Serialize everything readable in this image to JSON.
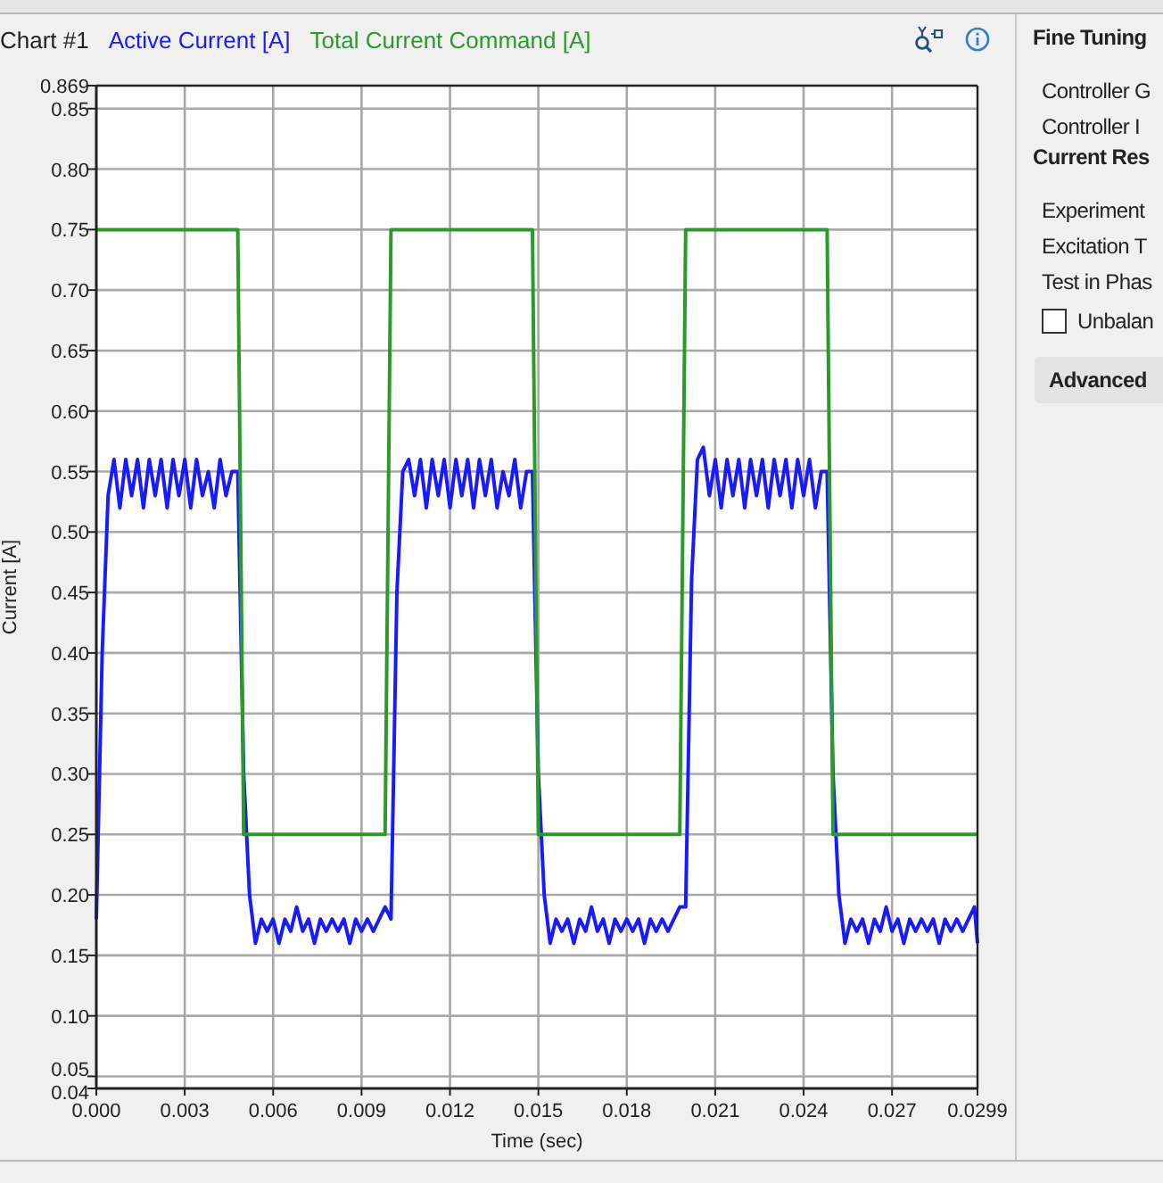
{
  "chart_panel": {
    "title": "Chart #1",
    "chart_data": {
      "type": "line",
      "grid": true,
      "xlabel": "Time (sec)",
      "ylabel": "Current [A]",
      "xlim": [
        0,
        0.0299
      ],
      "ylim": [
        0.04,
        0.869
      ],
      "xticks": [
        {
          "value": 0,
          "label": "0.000"
        },
        {
          "value": 0.003,
          "label": "0.003"
        },
        {
          "value": 0.006,
          "label": "0.006"
        },
        {
          "value": 0.009,
          "label": "0.009"
        },
        {
          "value": 0.012,
          "label": "0.012"
        },
        {
          "value": 0.015,
          "label": "0.015"
        },
        {
          "value": 0.018,
          "label": "0.018"
        },
        {
          "value": 0.021,
          "label": "0.021"
        },
        {
          "value": 0.024,
          "label": "0.024"
        },
        {
          "value": 0.027,
          "label": "0.027"
        },
        {
          "value": 0.0299,
          "label": "0.0299"
        }
      ],
      "yticks": [
        {
          "value": 0.04,
          "label": "0.04"
        },
        {
          "value": 0.05,
          "label": "0.05"
        },
        {
          "value": 0.1,
          "label": "0.10"
        },
        {
          "value": 0.15,
          "label": "0.15"
        },
        {
          "value": 0.2,
          "label": "0.20"
        },
        {
          "value": 0.25,
          "label": "0.25"
        },
        {
          "value": 0.3,
          "label": "0.30"
        },
        {
          "value": 0.35,
          "label": "0.35"
        },
        {
          "value": 0.4,
          "label": "0.40"
        },
        {
          "value": 0.45,
          "label": "0.45"
        },
        {
          "value": 0.5,
          "label": "0.50"
        },
        {
          "value": 0.55,
          "label": "0.55"
        },
        {
          "value": 0.6,
          "label": "0.60"
        },
        {
          "value": 0.65,
          "label": "0.65"
        },
        {
          "value": 0.7,
          "label": "0.70"
        },
        {
          "value": 0.75,
          "label": "0.75"
        },
        {
          "value": 0.8,
          "label": "0.80"
        },
        {
          "value": 0.85,
          "label": "0.85"
        },
        {
          "value": 0.869,
          "label": "0.869"
        }
      ],
      "x": [
        0,
        0.0002,
        0.0004,
        0.0006,
        0.0008,
        0.001,
        0.0012,
        0.0014,
        0.0016,
        0.0018,
        0.002,
        0.0022,
        0.0024,
        0.0026,
        0.0028,
        0.003,
        0.0032,
        0.0034,
        0.0036,
        0.0038,
        0.004,
        0.0042,
        0.0044,
        0.0046,
        0.0048,
        0.005,
        0.0052,
        0.0054,
        0.0056,
        0.0058,
        0.006,
        0.0062,
        0.0064,
        0.0066,
        0.0068,
        0.007,
        0.0072,
        0.0074,
        0.0076,
        0.0078,
        0.008,
        0.0082,
        0.0084,
        0.0086,
        0.0088,
        0.009,
        0.0092,
        0.0094,
        0.0096,
        0.0098,
        0.01,
        0.0102,
        0.0104,
        0.0106,
        0.0108,
        0.011,
        0.0112,
        0.0114,
        0.0116,
        0.0118,
        0.012,
        0.0122,
        0.0124,
        0.0126,
        0.0128,
        0.013,
        0.0132,
        0.0134,
        0.0136,
        0.0138,
        0.014,
        0.0142,
        0.0144,
        0.0146,
        0.0148,
        0.015,
        0.0152,
        0.0154,
        0.0156,
        0.0158,
        0.016,
        0.0162,
        0.0164,
        0.0166,
        0.0168,
        0.017,
        0.0172,
        0.0174,
        0.0176,
        0.0178,
        0.018,
        0.0182,
        0.0184,
        0.0186,
        0.0188,
        0.019,
        0.0192,
        0.0194,
        0.0196,
        0.0198,
        0.02,
        0.0202,
        0.0204,
        0.0206,
        0.0208,
        0.021,
        0.0212,
        0.0214,
        0.0216,
        0.0218,
        0.022,
        0.0222,
        0.0224,
        0.0226,
        0.0228,
        0.023,
        0.0232,
        0.0234,
        0.0236,
        0.0238,
        0.024,
        0.0242,
        0.0244,
        0.0246,
        0.0248,
        0.025,
        0.0252,
        0.0254,
        0.0256,
        0.0258,
        0.026,
        0.0262,
        0.0264,
        0.0266,
        0.0268,
        0.027,
        0.0272,
        0.0274,
        0.0276,
        0.0278,
        0.028,
        0.0282,
        0.0284,
        0.0286,
        0.0288,
        0.029,
        0.0292,
        0.0294,
        0.0296,
        0.0298,
        0.0299
      ],
      "series": [
        {
          "name": "Active Current [A]",
          "color": "#1a1aff",
          "values": [
            0.18,
            0.4,
            0.53,
            0.56,
            0.52,
            0.56,
            0.53,
            0.56,
            0.52,
            0.56,
            0.53,
            0.56,
            0.52,
            0.56,
            0.53,
            0.56,
            0.52,
            0.56,
            0.53,
            0.55,
            0.52,
            0.56,
            0.53,
            0.55,
            0.55,
            0.3,
            0.2,
            0.16,
            0.18,
            0.17,
            0.18,
            0.16,
            0.18,
            0.17,
            0.19,
            0.17,
            0.18,
            0.16,
            0.18,
            0.17,
            0.18,
            0.17,
            0.18,
            0.16,
            0.18,
            0.17,
            0.18,
            0.17,
            0.18,
            0.19,
            0.18,
            0.45,
            0.55,
            0.56,
            0.53,
            0.56,
            0.52,
            0.56,
            0.53,
            0.56,
            0.52,
            0.56,
            0.53,
            0.56,
            0.52,
            0.56,
            0.53,
            0.56,
            0.52,
            0.55,
            0.53,
            0.56,
            0.52,
            0.55,
            0.55,
            0.3,
            0.2,
            0.16,
            0.18,
            0.17,
            0.18,
            0.16,
            0.18,
            0.17,
            0.19,
            0.17,
            0.18,
            0.16,
            0.18,
            0.17,
            0.18,
            0.17,
            0.18,
            0.16,
            0.18,
            0.17,
            0.18,
            0.17,
            0.18,
            0.19,
            0.19,
            0.46,
            0.56,
            0.57,
            0.53,
            0.56,
            0.52,
            0.56,
            0.53,
            0.56,
            0.52,
            0.56,
            0.53,
            0.56,
            0.52,
            0.56,
            0.53,
            0.56,
            0.52,
            0.56,
            0.53,
            0.56,
            0.52,
            0.55,
            0.55,
            0.3,
            0.2,
            0.16,
            0.18,
            0.17,
            0.18,
            0.16,
            0.18,
            0.17,
            0.19,
            0.17,
            0.18,
            0.16,
            0.18,
            0.17,
            0.18,
            0.17,
            0.18,
            0.16,
            0.18,
            0.17,
            0.18,
            0.17,
            0.18,
            0.19,
            0.16
          ]
        },
        {
          "name": "Total Current Command [A]",
          "color": "#2a9a2a",
          "values": [
            0.75,
            0.75,
            0.75,
            0.75,
            0.75,
            0.75,
            0.75,
            0.75,
            0.75,
            0.75,
            0.75,
            0.75,
            0.75,
            0.75,
            0.75,
            0.75,
            0.75,
            0.75,
            0.75,
            0.75,
            0.75,
            0.75,
            0.75,
            0.75,
            0.75,
            0.25,
            0.25,
            0.25,
            0.25,
            0.25,
            0.25,
            0.25,
            0.25,
            0.25,
            0.25,
            0.25,
            0.25,
            0.25,
            0.25,
            0.25,
            0.25,
            0.25,
            0.25,
            0.25,
            0.25,
            0.25,
            0.25,
            0.25,
            0.25,
            0.25,
            0.75,
            0.75,
            0.75,
            0.75,
            0.75,
            0.75,
            0.75,
            0.75,
            0.75,
            0.75,
            0.75,
            0.75,
            0.75,
            0.75,
            0.75,
            0.75,
            0.75,
            0.75,
            0.75,
            0.75,
            0.75,
            0.75,
            0.75,
            0.75,
            0.75,
            0.25,
            0.25,
            0.25,
            0.25,
            0.25,
            0.25,
            0.25,
            0.25,
            0.25,
            0.25,
            0.25,
            0.25,
            0.25,
            0.25,
            0.25,
            0.25,
            0.25,
            0.25,
            0.25,
            0.25,
            0.25,
            0.25,
            0.25,
            0.25,
            0.25,
            0.75,
            0.75,
            0.75,
            0.75,
            0.75,
            0.75,
            0.75,
            0.75,
            0.75,
            0.75,
            0.75,
            0.75,
            0.75,
            0.75,
            0.75,
            0.75,
            0.75,
            0.75,
            0.75,
            0.75,
            0.75,
            0.75,
            0.75,
            0.75,
            0.75,
            0.25,
            0.25,
            0.25,
            0.25,
            0.25,
            0.25,
            0.25,
            0.25,
            0.25,
            0.25,
            0.25,
            0.25,
            0.25,
            0.25,
            0.25,
            0.25,
            0.25,
            0.25,
            0.25,
            0.25,
            0.25,
            0.25,
            0.25,
            0.25,
            0.25,
            0.25
          ]
        }
      ]
    }
  },
  "settings_panel": {
    "sections": [
      {
        "title": "Fine Tuning",
        "items": [
          {
            "kind": "text",
            "label": "Controller G"
          },
          {
            "kind": "text",
            "label": "Controller I"
          }
        ]
      },
      {
        "title": "Current Res",
        "items": [
          {
            "kind": "text",
            "label": "Experiment"
          },
          {
            "kind": "text",
            "label": "Excitation T"
          },
          {
            "kind": "text",
            "label": "Test in Phas"
          },
          {
            "kind": "checkbox",
            "label": "Unbalan",
            "checked": false
          },
          {
            "kind": "button",
            "label": "Advanced"
          }
        ]
      }
    ]
  }
}
